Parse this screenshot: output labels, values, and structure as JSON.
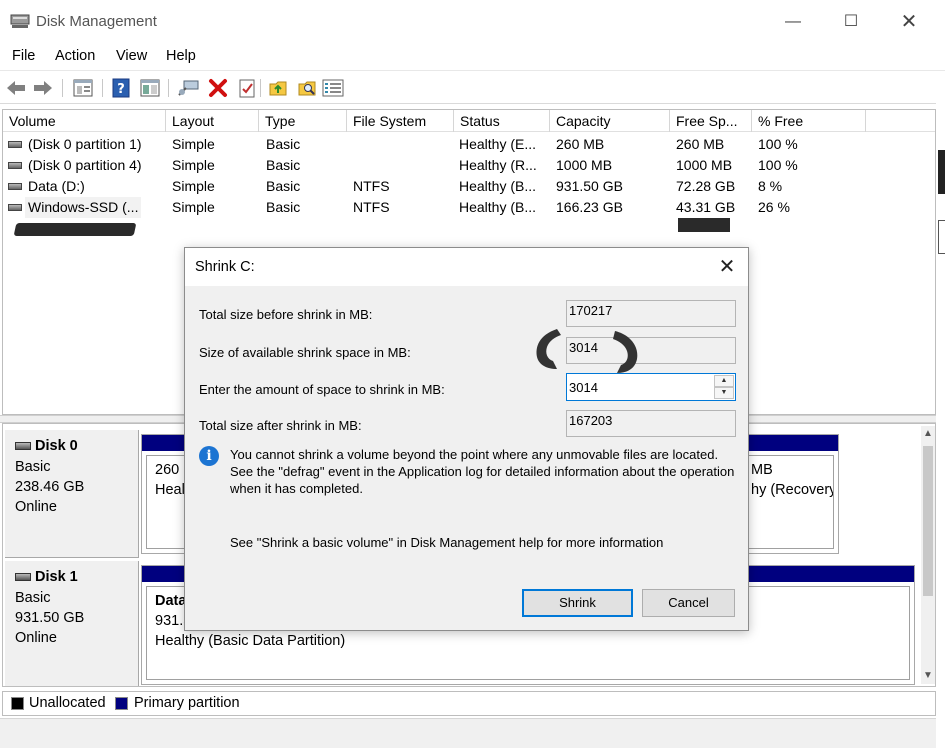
{
  "window": {
    "title": "Disk Management",
    "min_glyph": "—",
    "max_glyph": "☐",
    "close_glyph": "✕"
  },
  "menu": [
    "File",
    "Action",
    "View",
    "Help"
  ],
  "toolbar_icons": [
    "back-arrow-icon",
    "forward-arrow-icon",
    "console-tree-icon",
    "help-icon",
    "properties-icon",
    "connect-icon",
    "delete-icon",
    "check-icon",
    "folder-up-icon",
    "search-folder-icon",
    "list-icon"
  ],
  "volume_table": {
    "columns": [
      "Volume",
      "Layout",
      "Type",
      "File System",
      "Status",
      "Capacity",
      "Free Sp...",
      "% Free"
    ],
    "rows": [
      [
        "(Disk 0 partition 1)",
        "Simple",
        "Basic",
        "",
        "Healthy (E...",
        "260 MB",
        "260 MB",
        "100 %"
      ],
      [
        "(Disk 0 partition 4)",
        "Simple",
        "Basic",
        "",
        "Healthy (R...",
        "1000 MB",
        "1000 MB",
        "100 %"
      ],
      [
        "Data (D:)",
        "Simple",
        "Basic",
        "NTFS",
        "Healthy (B...",
        "931.50 GB",
        "72.28 GB",
        "8 %"
      ],
      [
        "Windows-SSD (...",
        "Simple",
        "Basic",
        "NTFS",
        "Healthy (B...",
        "166.23 GB",
        "43.31 GB",
        "26 %"
      ]
    ]
  },
  "disks": [
    {
      "name": "Disk 0",
      "type": "Basic",
      "size": "238.46 GB",
      "status": "Online",
      "partition_left_lines": [
        "260 M",
        "Healt"
      ],
      "partition_right_lines": [
        "MB",
        "hy (Recovery"
      ]
    },
    {
      "name": "Disk 1",
      "type": "Basic",
      "size": "931.50 GB",
      "status": "Online",
      "partition_lines": [
        "Data",
        "931.5",
        "Healthy (Basic Data Partition)"
      ]
    }
  ],
  "legend": [
    {
      "label": "Unallocated",
      "color": "#000000"
    },
    {
      "label": "Primary partition",
      "color": "#00007f"
    }
  ],
  "colors": {
    "primary_partition": "#00007f",
    "accent": "#0078d7",
    "info": "#1c74d2"
  },
  "dialog": {
    "title": "Shrink C:",
    "close_glyph": "✕",
    "total_before_label": "Total size before shrink in MB:",
    "total_before_value": "170217",
    "available_label": "Size of available shrink space in MB:",
    "available_value": "3014",
    "amount_label": "Enter the amount of space to shrink in MB:",
    "amount_value": "3014",
    "total_after_label": "Total size after shrink in MB:",
    "total_after_value": "167203",
    "info_text": "You cannot shrink a volume beyond the point where any unmovable files are located. See the \"defrag\" event in the Application log for detailed information about the operation when it has completed.",
    "help_text": "See \"Shrink a basic volume\" in Disk Management help for more information",
    "shrink_label": "Shrink",
    "cancel_label": "Cancel"
  }
}
